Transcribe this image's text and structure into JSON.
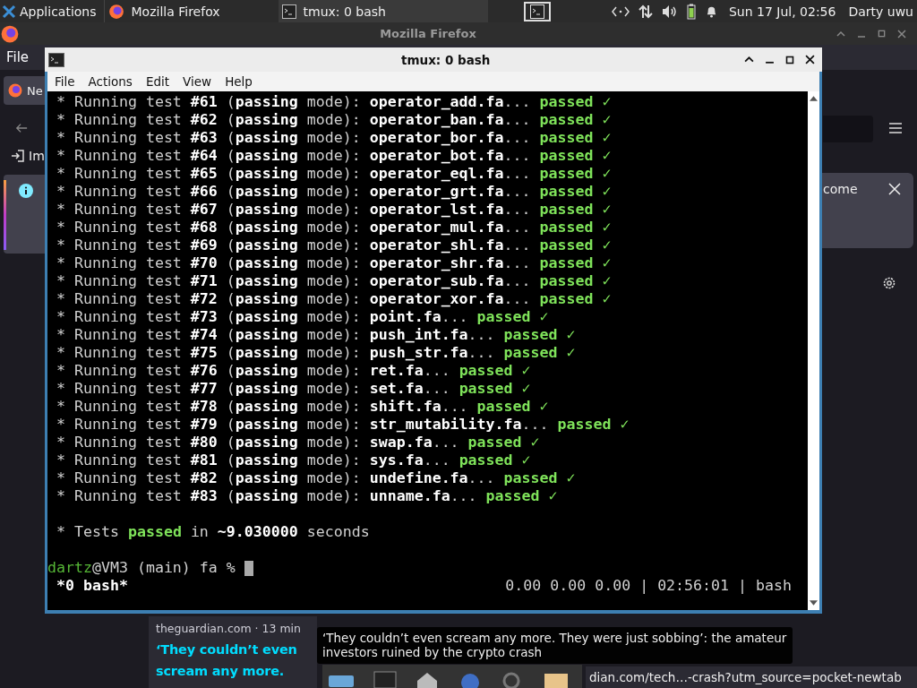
{
  "top_panel": {
    "applications": "Applications",
    "tasks": [
      {
        "title": "Mozilla Firefox",
        "kind": "firefox",
        "selected": false
      },
      {
        "title": "tmux: 0 bash",
        "kind": "terminal",
        "selected": true
      }
    ],
    "clock": "Sun 17 Jul, 02:56",
    "user": "Darty uwu"
  },
  "firefox": {
    "title": "Mozilla Firefox",
    "menu": [
      "File"
    ],
    "tab": "Ne",
    "bookmark": "Im",
    "notice_text": "come",
    "story": {
      "source": "theguardian.com · 13 min",
      "headline": "‘They couldn’t even scream any more."
    },
    "tooltip": "‘They couldn’t even scream any more. They were just sobbing’: the amateur investors ruined by the crypto crash",
    "status_url": "dian.com/tech…-crash?utm_source=pocket-newtab"
  },
  "terminal": {
    "title": "tmux: 0 bash",
    "menu": [
      "File",
      "Actions",
      "Edit",
      "View",
      "Help"
    ],
    "lines": [
      {
        "text": "* Running test **#61** (**passing** mode): **operator_add.fa**... ",
        "status": "passed ✓"
      },
      {
        "text": "* Running test **#62** (**passing** mode): **operator_ban.fa**... ",
        "status": "passed ✓"
      },
      {
        "text": "* Running test **#63** (**passing** mode): **operator_bor.fa**... ",
        "status": "passed ✓"
      },
      {
        "text": "* Running test **#64** (**passing** mode): **operator_bot.fa**... ",
        "status": "passed ✓"
      },
      {
        "text": "* Running test **#65** (**passing** mode): **operator_eql.fa**... ",
        "status": "passed ✓"
      },
      {
        "text": "* Running test **#66** (**passing** mode): **operator_grt.fa**... ",
        "status": "passed ✓"
      },
      {
        "text": "* Running test **#67** (**passing** mode): **operator_lst.fa**... ",
        "status": "passed ✓"
      },
      {
        "text": "* Running test **#68** (**passing** mode): **operator_mul.fa**... ",
        "status": "passed ✓"
      },
      {
        "text": "* Running test **#69** (**passing** mode): **operator_shl.fa**... ",
        "status": "passed ✓"
      },
      {
        "text": "* Running test **#70** (**passing** mode): **operator_shr.fa**... ",
        "status": "passed ✓"
      },
      {
        "text": "* Running test **#71** (**passing** mode): **operator_sub.fa**... ",
        "status": "passed ✓"
      },
      {
        "text": "* Running test **#72** (**passing** mode): **operator_xor.fa**... ",
        "status": "passed ✓"
      },
      {
        "text": "* Running test **#73** (**passing** mode): **point.fa**... ",
        "status": "passed ✓"
      },
      {
        "text": "* Running test **#74** (**passing** mode): **push_int.fa**... ",
        "status": "passed ✓"
      },
      {
        "text": "* Running test **#75** (**passing** mode): **push_str.fa**... ",
        "status": "passed ✓"
      },
      {
        "text": "* Running test **#76** (**passing** mode): **ret.fa**... ",
        "status": "passed ✓"
      },
      {
        "text": "* Running test **#77** (**passing** mode): **set.fa**... ",
        "status": "passed ✓"
      },
      {
        "text": "* Running test **#78** (**passing** mode): **shift.fa**... ",
        "status": "passed ✓"
      },
      {
        "text": "* Running test **#79** (**passing** mode): **str_mutability.fa**... ",
        "status": "passed ✓"
      },
      {
        "text": "* Running test **#80** (**passing** mode): **swap.fa**... ",
        "status": "passed ✓"
      },
      {
        "text": "* Running test **#81** (**passing** mode): **sys.fa**... ",
        "status": "passed ✓"
      },
      {
        "text": "* Running test **#82** (**passing** mode): **undefine.fa**... ",
        "status": "passed ✓"
      },
      {
        "text": "* Running test **#83** (**passing** mode): **unname.fa**... ",
        "status": "passed ✓"
      }
    ],
    "summary": [
      {
        "text": "* Tests ",
        "kind": "plain"
      },
      {
        "text": "passed",
        "kind": "ok"
      },
      {
        "text": " in ",
        "kind": "plain"
      },
      {
        "text": "~9.030000",
        "kind": "bold"
      },
      {
        "text": " seconds",
        "kind": "plain"
      }
    ],
    "prompt": {
      "user": "dartz",
      "rest": "@VM3 (main) fa % "
    },
    "status_left": "*0 bash*",
    "status_right": "0.00 0.00 0.00 | 02:56:01 | bash"
  }
}
